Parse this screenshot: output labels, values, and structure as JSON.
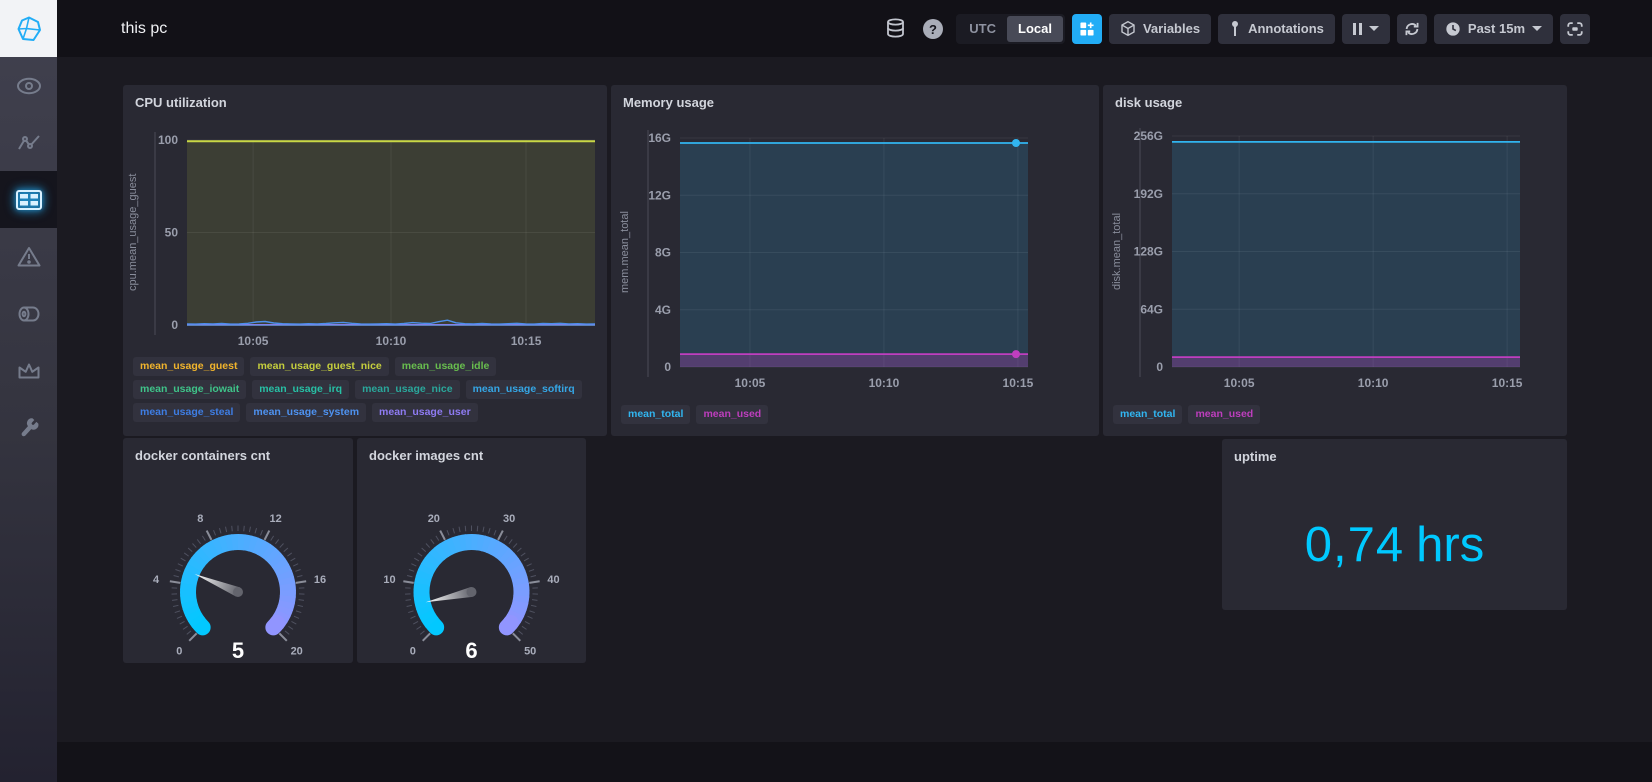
{
  "header": {
    "title": "this pc",
    "timezone": {
      "options": [
        "UTC",
        "Local"
      ],
      "selected": "Local"
    },
    "variables_label": "Variables",
    "annotations_label": "Annotations",
    "pause_label": "pause",
    "time_range_label": "Past 15m",
    "accent_color": "#22adf6",
    "icons": [
      "sources-database-icon",
      "help-icon",
      "add-cell-icon",
      "cube-icon",
      "annotation-pin-icon",
      "pause-icon",
      "refresh-icon",
      "clock-icon",
      "presentation-mode-icon"
    ]
  },
  "sidebar": {
    "icons": [
      "chronograf-logo",
      "eye-icon",
      "data-explorer-icon",
      "dashboards-icon",
      "alert-triangle-icon",
      "log-viewer-icon",
      "admin-crown-icon",
      "config-wrench-icon"
    ],
    "active_item": "dashboards"
  },
  "chart_data": [
    {
      "type": "line",
      "title": "CPU utilization",
      "ylabel": "cpu.mean_usage_guest",
      "ylim": [
        0,
        100
      ],
      "grid": true,
      "yticks": [
        {
          "v": 0,
          "label": "0"
        },
        {
          "v": 50,
          "label": "50"
        },
        {
          "v": 100,
          "label": "100"
        }
      ],
      "xticks": [
        {
          "frac": 0.162,
          "label": "10:05"
        },
        {
          "frac": 0.5,
          "label": "10:10"
        },
        {
          "frac": 0.831,
          "label": "10:15"
        }
      ],
      "series": [
        {
          "name": "mean_usage_guest",
          "color": "#F1B42C",
          "values": [
            0.02
          ],
          "fill_opacity": 0,
          "width": 1.2
        },
        {
          "name": "mean_usage_guest_nice",
          "color": "#C5CE3D",
          "values": [
            0.02
          ],
          "fill_opacity": 0,
          "width": 1.2
        },
        {
          "name": "mean_usage_idle",
          "color": "#C9D845",
          "values": [
            99.3
          ],
          "fill_opacity": 0.12,
          "width": 2
        },
        {
          "name": "mean_usage_iowait",
          "color": "#3FC389",
          "values": [
            0.06
          ],
          "fill_opacity": 0,
          "width": 1.2
        },
        {
          "name": "mean_usage_irq",
          "color": "#27C0A5",
          "values": [
            0.02
          ],
          "fill_opacity": 0,
          "width": 1.2
        },
        {
          "name": "mean_usage_nice",
          "color": "#2AA79B",
          "values": [
            0.02
          ],
          "fill_opacity": 0,
          "width": 1.2
        },
        {
          "name": "mean_usage_softirq",
          "color": "#35A6E5",
          "values": [
            0.04
          ],
          "fill_opacity": 0,
          "width": 1.2
        },
        {
          "name": "mean_usage_steal",
          "color": "#3E7DE3",
          "values": [
            0.02
          ],
          "fill_opacity": 0,
          "width": 1.2
        },
        {
          "name": "mean_usage_user",
          "color": "#8E7BF2",
          "values": [
            0.18
          ],
          "fill_opacity": 0,
          "width": 1.2
        },
        {
          "name": "mean_usage_system",
          "color": "#4C90EC",
          "values": [
            0.6,
            0.5,
            0.7,
            0.6,
            0.8,
            0.5,
            0.6,
            0.9,
            1.6,
            1.9,
            1.1,
            0.7,
            0.6,
            0.5,
            0.7,
            0.6,
            0.8,
            1.2,
            1.4,
            0.9,
            0.6,
            0.5,
            0.6,
            0.7,
            0.5,
            0.8,
            1.3,
            1.0,
            0.8,
            1.8,
            2.6,
            1.2,
            0.7,
            0.6,
            0.8,
            0.6,
            0.5,
            0.7,
            0.9,
            0.6,
            0.5,
            0.8,
            0.7,
            0.9,
            0.6,
            0.7,
            0.5,
            0.6
          ],
          "fill_opacity": 0,
          "width": 1.4
        }
      ],
      "legend": [
        {
          "label": "mean_usage_guest",
          "color": "#F1B42C"
        },
        {
          "label": "mean_usage_guest_nice",
          "color": "#C5CE3D"
        },
        {
          "label": "mean_usage_idle",
          "color": "#68BD4E"
        },
        {
          "label": "mean_usage_iowait",
          "color": "#3FC389"
        },
        {
          "label": "mean_usage_irq",
          "color": "#27C0A5"
        },
        {
          "label": "mean_usage_nice",
          "color": "#2AA79B"
        },
        {
          "label": "mean_usage_softirq",
          "color": "#35A6E5"
        },
        {
          "label": "mean_usage_steal",
          "color": "#3E7DE3"
        },
        {
          "label": "mean_usage_system",
          "color": "#4E92F0"
        },
        {
          "label": "mean_usage_user",
          "color": "#8E7BF2"
        }
      ]
    },
    {
      "type": "line",
      "title": "Memory usage",
      "ylabel": "mem.mean_total",
      "ylim": [
        0,
        16
      ],
      "grid": true,
      "yticks": [
        {
          "v": 0,
          "label": "0"
        },
        {
          "v": 4,
          "label": "4G"
        },
        {
          "v": 8,
          "label": "8G"
        },
        {
          "v": 12,
          "label": "12G"
        },
        {
          "v": 16,
          "label": "16G"
        }
      ],
      "xticks": [
        {
          "frac": 0.201,
          "label": "10:05"
        },
        {
          "frac": 0.586,
          "label": "10:10"
        },
        {
          "frac": 0.971,
          "label": "10:15"
        }
      ],
      "series": [
        {
          "name": "mean_total",
          "color": "#31B5F0",
          "values": [
            15.65
          ],
          "fill_opacity": 0.16,
          "width": 1.8,
          "end_dot": true
        },
        {
          "name": "mean_used",
          "color": "#C03EC0",
          "values": [
            0.9
          ],
          "fill_opacity": 0.28,
          "width": 1.8,
          "end_dot": true
        }
      ],
      "legend": [
        {
          "label": "mean_total",
          "color": "#31B5F0"
        },
        {
          "label": "mean_used",
          "color": "#BD3EBD"
        }
      ]
    },
    {
      "type": "line",
      "title": "disk usage",
      "ylabel": "disk.mean_total",
      "ylim": [
        0,
        256
      ],
      "grid": true,
      "yticks": [
        {
          "v": 0,
          "label": "0"
        },
        {
          "v": 64,
          "label": "64G"
        },
        {
          "v": 128,
          "label": "128G"
        },
        {
          "v": 192,
          "label": "192G"
        },
        {
          "v": 256,
          "label": "256G"
        }
      ],
      "xticks": [
        {
          "frac": 0.193,
          "label": "10:05"
        },
        {
          "frac": 0.578,
          "label": "10:10"
        },
        {
          "frac": 0.963,
          "label": "10:15"
        }
      ],
      "series": [
        {
          "name": "mean_total",
          "color": "#31B5F0",
          "values": [
            249.5
          ],
          "fill_opacity": 0.16,
          "width": 1.8
        },
        {
          "name": "mean_used",
          "color": "#C03EC0",
          "values": [
            11
          ],
          "fill_opacity": 0.28,
          "width": 1.8
        }
      ],
      "legend": [
        {
          "label": "mean_total",
          "color": "#31B5F0"
        },
        {
          "label": "mean_used",
          "color": "#BD3EBD"
        }
      ]
    },
    {
      "type": "gauge",
      "title": "docker containers cnt",
      "min": 0,
      "max": 20,
      "tick_labels": [
        "0",
        "4",
        "8",
        "12",
        "16",
        "20"
      ],
      "value": 5,
      "value_label": "5",
      "colors": [
        "#00C9FF",
        "#9394FF"
      ]
    },
    {
      "type": "gauge",
      "title": "docker images cnt",
      "min": 0,
      "max": 50,
      "tick_labels": [
        "0",
        "10",
        "20",
        "30",
        "40",
        "50"
      ],
      "value": 6,
      "value_label": "6",
      "colors": [
        "#00C9FF",
        "#9394FF"
      ]
    },
    {
      "type": "single_stat",
      "title": "uptime",
      "value": "0,74",
      "unit": "hrs",
      "color": "#00C9FF"
    }
  ]
}
